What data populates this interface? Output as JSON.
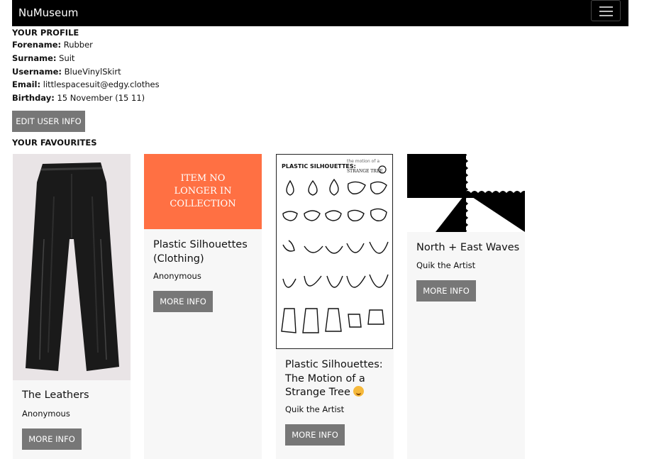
{
  "navbar": {
    "brand": "NuMuseum",
    "toggle_icon": "hamburger-menu-icon"
  },
  "profile": {
    "heading": "YOUR PROFILE",
    "fields": [
      {
        "label": "Forename:",
        "value": "Rubber"
      },
      {
        "label": "Surname:",
        "value": "Suit"
      },
      {
        "label": "Username:",
        "value": "BlueVinylSkirt"
      },
      {
        "label": "Email:",
        "value": "littlespacesuit@edgy.clothes"
      },
      {
        "label": "Birthday:",
        "value": "15 November (15 11)"
      }
    ],
    "edit_label": "EDIT USER INFO"
  },
  "favourites": {
    "heading": "YOUR FAVOURITES",
    "items": [
      {
        "title": "The Leathers",
        "artist": "Anonymous",
        "button": "MORE INFO",
        "image": "leather-trousers-photo"
      },
      {
        "title": "Plastic Silhouettes (Clothing)",
        "artist": "Anonymous",
        "button": "MORE INFO",
        "image_text": "ITEM NO LONGER IN COLLECTION"
      },
      {
        "title": "Plastic Silhouettes: The Motion of a Strange Tree",
        "title_icon": "grinning-emoji-icon",
        "artist": "Quik the Artist",
        "button": "MORE INFO",
        "image": "silhouette-sketch-sheet",
        "sheet_text": {
          "left": "PLASTIC SILHOUETTES:",
          "right_top": "the motion of a",
          "right_bottom": "STRANGE TREE"
        }
      },
      {
        "title": "North + East Waves",
        "artist": "Quik the Artist",
        "button": "MORE INFO",
        "image": "black-white-waves-artwork"
      }
    ]
  },
  "colors": {
    "navbar_bg": "#000000",
    "button_bg": "#777777",
    "placeholder_bg": "#ff7043",
    "card_bg": "#f7f7f7"
  }
}
